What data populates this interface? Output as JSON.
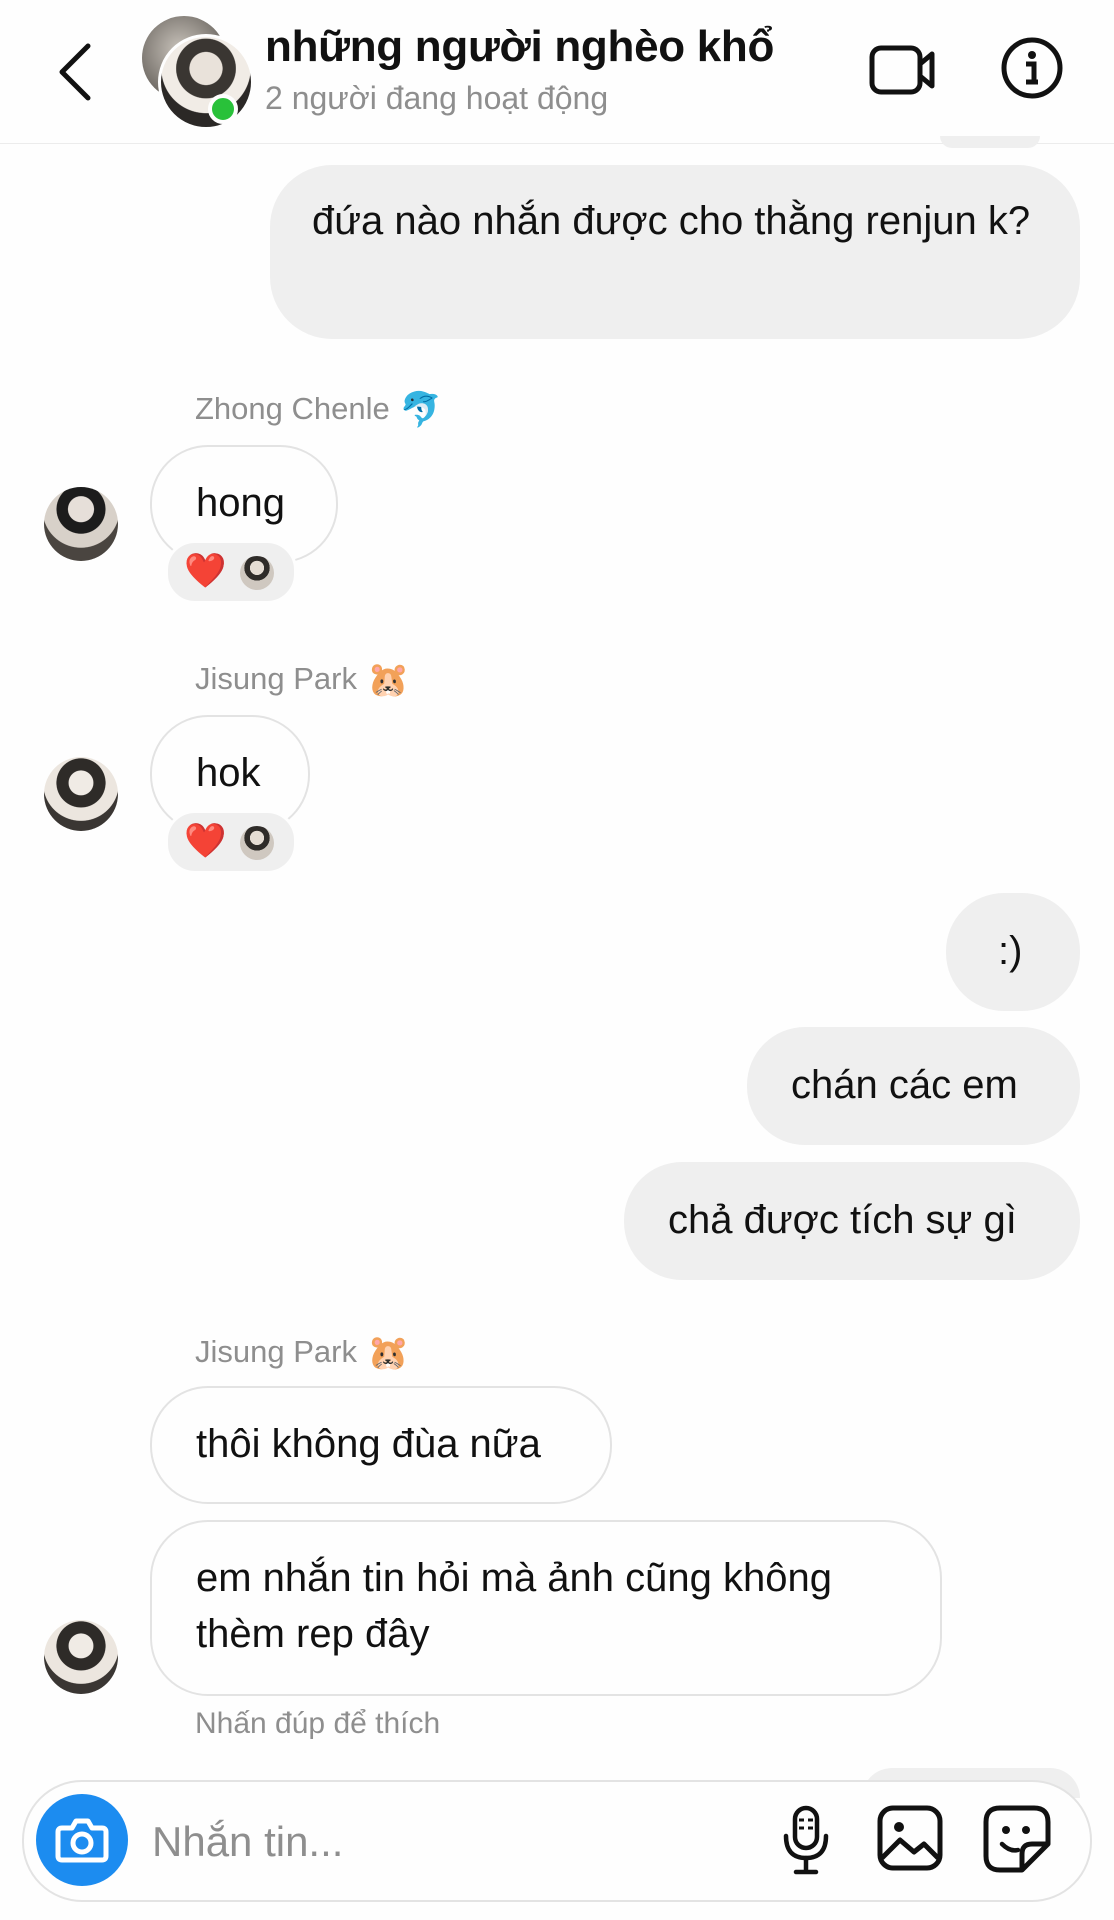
{
  "header": {
    "title": "những người nghèo khổ",
    "subtitle": "2 người đang hoạt động"
  },
  "messages": [
    {
      "type": "outgoing",
      "text": "đứa nào nhắn được cho thằng renjun k?"
    },
    {
      "type": "incoming",
      "sender": "Zhong Chenle",
      "sender_emoji": "🐬",
      "text": "hong",
      "reaction": "❤️"
    },
    {
      "type": "incoming",
      "sender": "Jisung Park",
      "sender_emoji": "🐹",
      "text": "hok",
      "reaction": "❤️"
    },
    {
      "type": "outgoing",
      "text": ":)"
    },
    {
      "type": "outgoing",
      "text": "chán các em"
    },
    {
      "type": "outgoing",
      "text": "chả được tích sự gì"
    },
    {
      "type": "incoming",
      "sender": "Jisung Park",
      "sender_emoji": "🐹",
      "text": "thôi không đùa nữa"
    },
    {
      "type": "incoming",
      "text": "em nhắn tin hỏi mà ảnh cũng không thèm rep đây"
    }
  ],
  "hint": "Nhấn đúp để thích",
  "composer": {
    "placeholder": "Nhắn tin..."
  },
  "colors": {
    "online": "#29c13a",
    "camera_button": "#1c8cf0",
    "outgoing_bubble": "#efefef",
    "reaction_heart": "#ed1c3a"
  },
  "icons": [
    "back-arrow-icon",
    "video-call-icon",
    "info-icon",
    "camera-icon",
    "microphone-icon",
    "gallery-icon",
    "sticker-icon"
  ]
}
